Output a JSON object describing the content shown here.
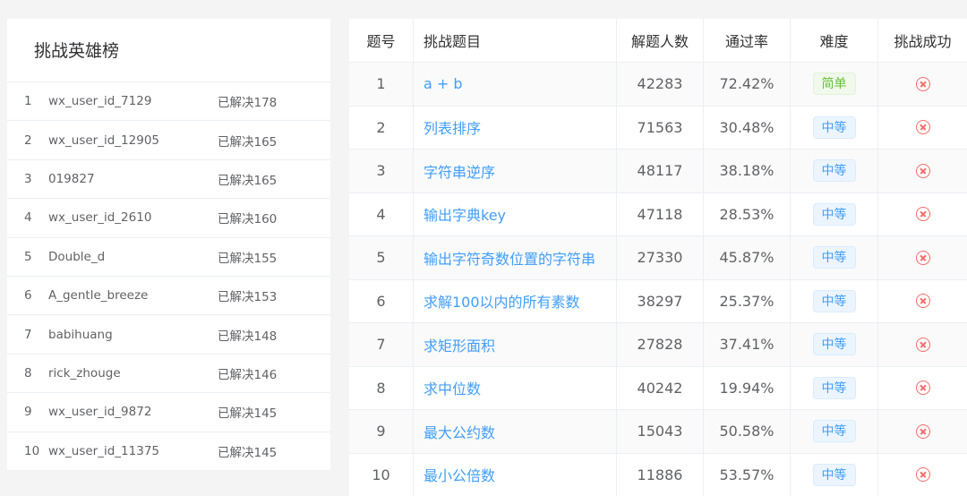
{
  "leaderboard": {
    "title": "挑战英雄榜",
    "entries": [
      {
        "rank": "1",
        "user": "wx_user_id_7129",
        "solved": "已解决178"
      },
      {
        "rank": "2",
        "user": "wx_user_id_12905",
        "solved": "已解决165"
      },
      {
        "rank": "3",
        "user": "019827",
        "solved": "已解决165"
      },
      {
        "rank": "4",
        "user": "wx_user_id_2610",
        "solved": "已解决160"
      },
      {
        "rank": "5",
        "user": "Double_d",
        "solved": "已解决155"
      },
      {
        "rank": "6",
        "user": "A_gentle_breeze",
        "solved": "已解决153"
      },
      {
        "rank": "7",
        "user": "babihuang",
        "solved": "已解决148"
      },
      {
        "rank": "8",
        "user": "rick_zhouge",
        "solved": "已解决146"
      },
      {
        "rank": "9",
        "user": "wx_user_id_9872",
        "solved": "已解决145"
      },
      {
        "rank": "10",
        "user": "wx_user_id_11375",
        "solved": "已解决145"
      }
    ]
  },
  "problems": {
    "headers": {
      "id": "题号",
      "title": "挑战题目",
      "solvers": "解题人数",
      "pass_rate": "通过率",
      "difficulty": "难度",
      "success": "挑战成功"
    },
    "rows": [
      {
        "id": "1",
        "title": "a + b",
        "solvers": "42283",
        "pass_rate": "72.42%",
        "difficulty": "简单",
        "level": "easy",
        "success_icon": "fail-circle-icon"
      },
      {
        "id": "2",
        "title": "列表排序",
        "solvers": "71563",
        "pass_rate": "30.48%",
        "difficulty": "中等",
        "level": "medium",
        "success_icon": "fail-circle-icon"
      },
      {
        "id": "3",
        "title": "字符串逆序",
        "solvers": "48117",
        "pass_rate": "38.18%",
        "difficulty": "中等",
        "level": "medium",
        "success_icon": "fail-circle-icon"
      },
      {
        "id": "4",
        "title": "输出字典key",
        "solvers": "47118",
        "pass_rate": "28.53%",
        "difficulty": "中等",
        "level": "medium",
        "success_icon": "fail-circle-icon"
      },
      {
        "id": "5",
        "title": "输出字符奇数位置的字符串",
        "solvers": "27330",
        "pass_rate": "45.87%",
        "difficulty": "中等",
        "level": "medium",
        "success_icon": "fail-circle-icon"
      },
      {
        "id": "6",
        "title": "求解100以内的所有素数",
        "solvers": "38297",
        "pass_rate": "25.37%",
        "difficulty": "中等",
        "level": "medium",
        "success_icon": "fail-circle-icon"
      },
      {
        "id": "7",
        "title": "求矩形面积",
        "solvers": "27828",
        "pass_rate": "37.41%",
        "difficulty": "中等",
        "level": "medium",
        "success_icon": "fail-circle-icon"
      },
      {
        "id": "8",
        "title": "求中位数",
        "solvers": "40242",
        "pass_rate": "19.94%",
        "difficulty": "中等",
        "level": "medium",
        "success_icon": "fail-circle-icon"
      },
      {
        "id": "9",
        "title": "最大公约数",
        "solvers": "15043",
        "pass_rate": "50.58%",
        "difficulty": "中等",
        "level": "medium",
        "success_icon": "fail-circle-icon"
      },
      {
        "id": "10",
        "title": "最小公倍数",
        "solvers": "11886",
        "pass_rate": "53.57%",
        "difficulty": "中等",
        "level": "medium",
        "success_icon": "fail-circle-icon"
      }
    ]
  },
  "colors": {
    "link": "#409eff",
    "easy": "#67c23a",
    "medium": "#409eff",
    "fail": "#f56c6c"
  }
}
